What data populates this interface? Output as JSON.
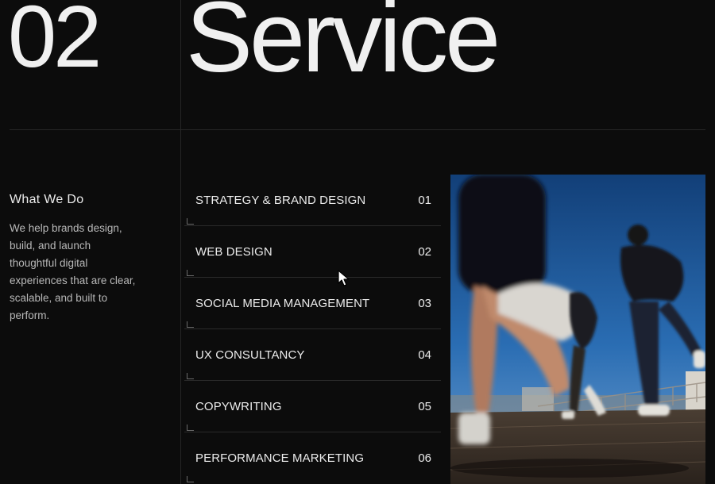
{
  "section": {
    "number": "02",
    "title": "Service"
  },
  "intro": {
    "heading": "What We Do",
    "body": "We help brands design, build, and launch thoughtful digital experiences that are clear, scalable, and built to perform."
  },
  "services": [
    {
      "label": "STRATEGY & BRAND DESIGN",
      "number": "01"
    },
    {
      "label": "WEB DESIGN",
      "number": "02"
    },
    {
      "label": "SOCIAL MEDIA MANAGEMENT",
      "number": "03"
    },
    {
      "label": "UX CONSULTANCY",
      "number": "04"
    },
    {
      "label": "COPYWRITING",
      "number": "05"
    },
    {
      "label": "PERFORMANCE MARKETING",
      "number": "06"
    }
  ],
  "photo": {
    "icon": "runners-photo"
  },
  "colors": {
    "background": "#0c0c0c",
    "text": "#ececec",
    "muted_text": "#b8b8b8",
    "divider": "#262626",
    "sky": "#1f5fa8"
  }
}
